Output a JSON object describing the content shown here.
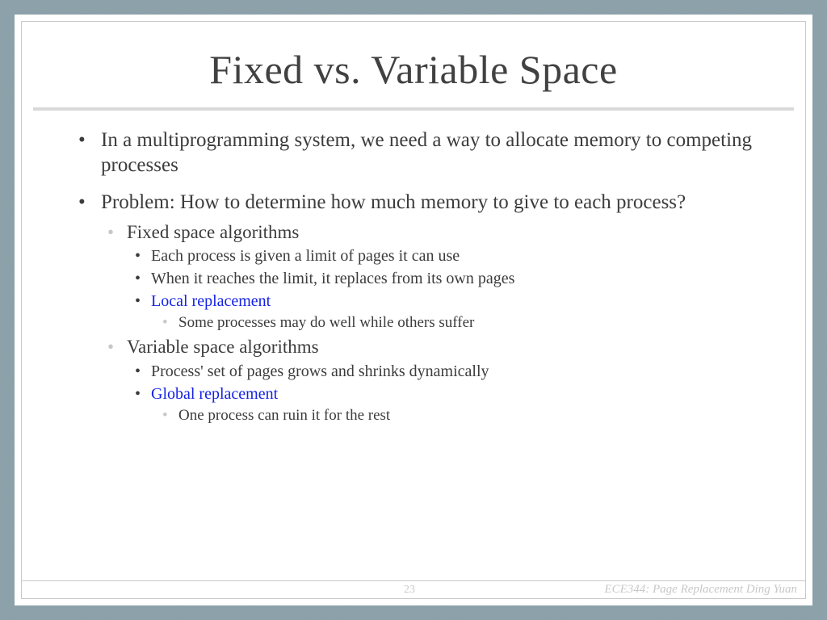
{
  "slide": {
    "title": "Fixed vs. Variable Space",
    "bullets": {
      "b1": "In a multiprogramming system, we need a way to allocate memory to competing processes",
      "b2": "Problem: How to determine how much memory to give to each process?",
      "fixed_heading": "Fixed space algorithms",
      "fixed_1": "Each process is given a limit of pages it can use",
      "fixed_2": "When it reaches the limit, it replaces from its own pages",
      "fixed_3": "Local replacement",
      "fixed_3_sub": "Some processes may do well while others suffer",
      "var_heading": "Variable space algorithms",
      "var_1": "Process' set of pages grows and shrinks dynamically",
      "var_2": "Global replacement",
      "var_2_sub": "One process can ruin it for the rest"
    },
    "footer": {
      "page_number": "23",
      "course_info": "ECE344: Page Replacement Ding Yuan"
    }
  }
}
